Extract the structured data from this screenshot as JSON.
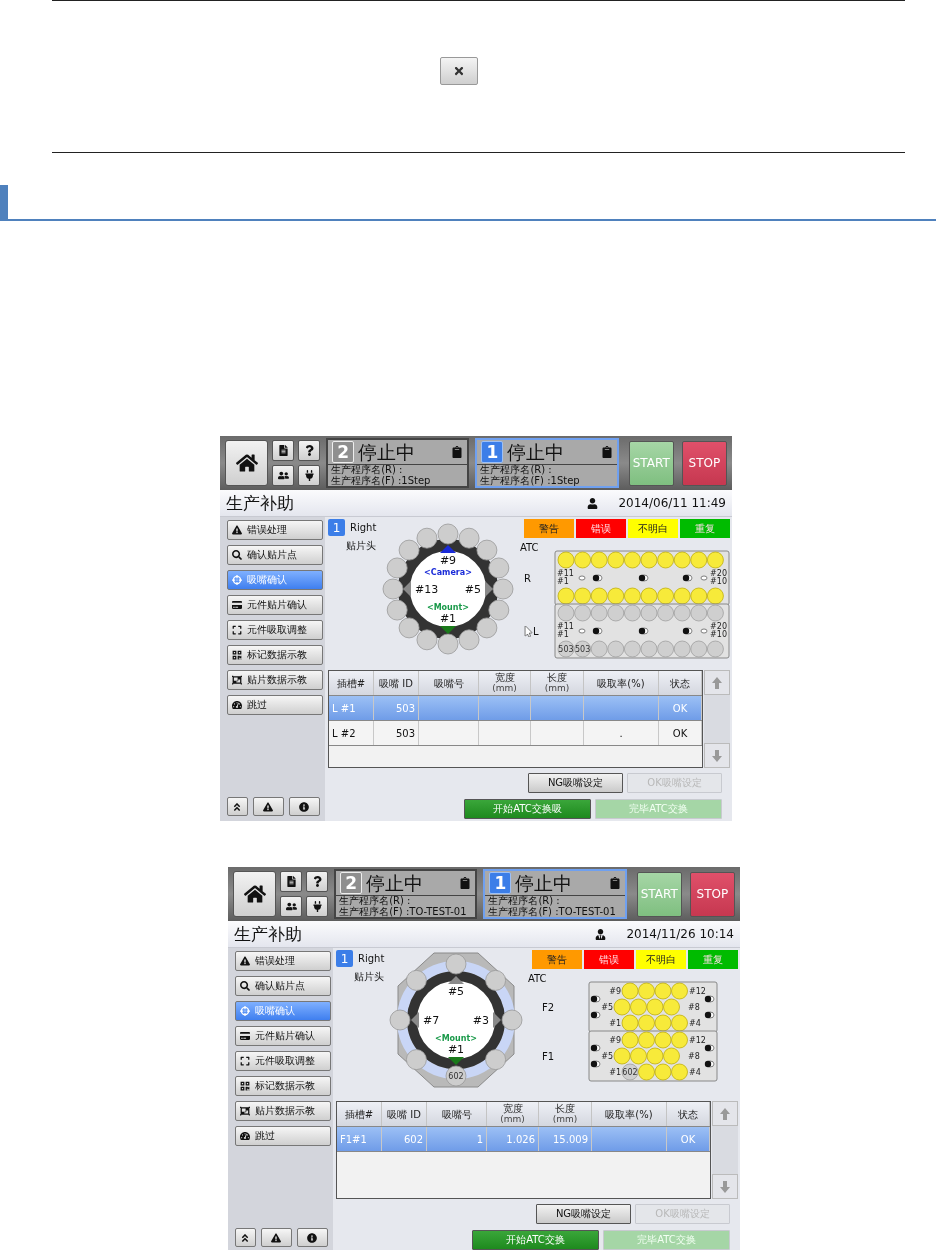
{
  "screens": [
    {
      "header": {
        "panels": [
          {
            "number": "2",
            "status": "停止中",
            "selected": false,
            "program_r": "生产程序名(R) :",
            "program_f": "生产程序名(F) :1Step"
          },
          {
            "number": "1",
            "status": "停止中",
            "selected": true,
            "program_r": "生产程序名(R) :",
            "program_f": "生产程序名(F) :1Step"
          }
        ],
        "start": "START",
        "stop": "STOP"
      },
      "title": "生产补助",
      "datetime": "2014/06/11 11:49",
      "sidebar": {
        "items": [
          {
            "label": "错误处理",
            "selected": false
          },
          {
            "label": "确认贴片点",
            "selected": false
          },
          {
            "label": "吸嘴确认",
            "selected": true
          },
          {
            "label": "元件贴片确认",
            "selected": false
          },
          {
            "label": "元件吸取调整",
            "selected": false
          },
          {
            "label": "标记数据示教",
            "selected": false
          },
          {
            "label": "贴片数据示教",
            "selected": false
          },
          {
            "label": "跳过",
            "selected": false
          }
        ]
      },
      "head": {
        "number": "1",
        "side": "Right",
        "label": "贴片头"
      },
      "wheel": {
        "kind": "round",
        "top": "#9",
        "camera": "<Camera>",
        "left": "#13",
        "right": "#5",
        "mount": "<Mount>",
        "bottom": "#1"
      },
      "legend": [
        {
          "label": "警告",
          "color": "#ff9900"
        },
        {
          "label": "错误",
          "color": "#ff0000"
        },
        {
          "label": "不明白",
          "color": "#ffff00"
        },
        {
          "label": "重复",
          "color": "#00bb00"
        }
      ],
      "atc": {
        "label": "ATC",
        "trays": [
          {
            "name": "R",
            "kind": "strip",
            "pointer": false,
            "marks": [
              "#11",
              "#1",
              "#20",
              "#10"
            ],
            "slots": [
              {
                "loaded": true
              },
              {
                "loaded": true
              },
              {
                "loaded": true
              },
              {
                "loaded": true
              },
              {
                "loaded": true
              },
              {
                "loaded": true
              },
              {
                "loaded": true
              },
              {
                "loaded": true
              },
              {
                "loaded": true
              },
              {
                "loaded": true
              },
              {
                "loaded": true
              },
              {
                "loaded": true
              },
              {
                "loaded": true
              },
              {
                "loaded": true
              },
              {
                "loaded": true
              },
              {
                "loaded": true
              },
              {
                "loaded": true
              },
              {
                "loaded": true
              },
              {
                "loaded": true
              },
              {
                "loaded": true
              }
            ]
          },
          {
            "name": "L",
            "kind": "strip",
            "pointer": true,
            "marks": [
              "#11",
              "#1",
              "#20",
              "#10"
            ],
            "slots": [
              {
                "loaded": false
              },
              {
                "loaded": false
              },
              {
                "loaded": false
              },
              {
                "loaded": false
              },
              {
                "loaded": false
              },
              {
                "loaded": false
              },
              {
                "loaded": false
              },
              {
                "loaded": false
              },
              {
                "loaded": false
              },
              {
                "loaded": false
              },
              {
                "loaded": false,
                "id": "503"
              },
              {
                "loaded": false,
                "id": "503"
              },
              {
                "loaded": false
              },
              {
                "loaded": false
              },
              {
                "loaded": false
              },
              {
                "loaded": false
              },
              {
                "loaded": false
              },
              {
                "loaded": false
              },
              {
                "loaded": false
              },
              {
                "loaded": false
              }
            ]
          }
        ]
      },
      "table": {
        "columns": [
          {
            "label": "插槽#"
          },
          {
            "label": "吸嘴 ID"
          },
          {
            "label": "吸嘴号"
          },
          {
            "label": "宽度",
            "unit": "(mm)"
          },
          {
            "label": "长度",
            "unit": "(mm)"
          },
          {
            "label": "吸取率(%)"
          },
          {
            "label": "状态"
          }
        ],
        "rows": [
          {
            "selected": true,
            "cells": [
              "L #1",
              "503",
              null,
              null,
              null,
              null,
              "OK"
            ]
          },
          {
            "selected": false,
            "cells": [
              "L #2",
              "503",
              null,
              null,
              null,
              ".",
              "OK"
            ]
          }
        ]
      },
      "setting_buttons": [
        {
          "label": "NG吸嘴设定",
          "disabled": false
        },
        {
          "label": "OK吸嘴设定",
          "disabled": true
        }
      ],
      "exchange_buttons": [
        {
          "label": "开始ATC交换吸",
          "disabled": false
        },
        {
          "label": "完毕ATC交换",
          "disabled": true
        }
      ]
    },
    {
      "header": {
        "panels": [
          {
            "number": "2",
            "status": "停止中",
            "selected": false,
            "program_r": "生产程序名(R) :",
            "program_f": "生产程序名(F) :TO-TEST-01"
          },
          {
            "number": "1",
            "status": "停止中",
            "selected": true,
            "program_r": "生产程序名(R) :",
            "program_f": "生产程序名(F) :TO-TEST-01"
          }
        ],
        "start": "START",
        "stop": "STOP"
      },
      "title": "生产补助",
      "datetime": "2014/11/26 10:14",
      "sidebar": {
        "items": [
          {
            "label": "错误处理",
            "selected": false
          },
          {
            "label": "确认贴片点",
            "selected": false
          },
          {
            "label": "吸嘴确认",
            "selected": true
          },
          {
            "label": "元件贴片确认",
            "selected": false
          },
          {
            "label": "元件吸取调整",
            "selected": false
          },
          {
            "label": "标记数据示教",
            "selected": false
          },
          {
            "label": "贴片数据示教",
            "selected": false
          },
          {
            "label": "跳过",
            "selected": false
          }
        ]
      },
      "head": {
        "number": "1",
        "side": "Right",
        "label": "贴片头"
      },
      "wheel": {
        "kind": "octagon",
        "top": "#5",
        "left": "#7",
        "right": "#3",
        "mount": "<Mount>",
        "bottom": "#1",
        "nozzle_id": "602"
      },
      "legend": [
        {
          "label": "警告",
          "color": "#ff9900"
        },
        {
          "label": "错误",
          "color": "#ff0000"
        },
        {
          "label": "不明白",
          "color": "#ffff00"
        },
        {
          "label": "重复",
          "color": "#00bb00"
        }
      ],
      "atc": {
        "label": "ATC",
        "trays": [
          {
            "name": "F2",
            "kind": "grid",
            "pointer": false,
            "marks": [
              "#9",
              "#12",
              "#5",
              "#8",
              "#1",
              "#4"
            ],
            "slots": [
              {
                "loaded": true
              },
              {
                "loaded": true
              },
              {
                "loaded": true
              },
              {
                "loaded": true
              },
              {
                "loaded": true
              },
              {
                "loaded": true
              },
              {
                "loaded": true
              },
              {
                "loaded": true
              },
              {
                "loaded": true
              },
              {
                "loaded": true
              },
              {
                "loaded": true
              },
              {
                "loaded": true
              }
            ]
          },
          {
            "name": "F1",
            "kind": "grid",
            "pointer": false,
            "marks": [
              "#9",
              "#12",
              "#5",
              "#8",
              "#1",
              "#4"
            ],
            "slots": [
              {
                "loaded": true
              },
              {
                "loaded": true
              },
              {
                "loaded": true
              },
              {
                "loaded": true
              },
              {
                "loaded": true
              },
              {
                "loaded": true
              },
              {
                "loaded": true
              },
              {
                "loaded": true
              },
              {
                "loaded": false,
                "id": "602"
              },
              {
                "loaded": true
              },
              {
                "loaded": true
              },
              {
                "loaded": true
              }
            ]
          }
        ]
      },
      "table": {
        "columns": [
          {
            "label": "插槽#"
          },
          {
            "label": "吸嘴 ID"
          },
          {
            "label": "吸嘴号"
          },
          {
            "label": "宽度",
            "unit": "(mm)"
          },
          {
            "label": "长度",
            "unit": "(mm)"
          },
          {
            "label": "吸取率(%)"
          },
          {
            "label": "状态"
          }
        ],
        "rows": [
          {
            "selected": true,
            "cells": [
              "F1#1",
              "602",
              "1",
              "1.026",
              "15.009",
              null,
              "OK"
            ]
          }
        ]
      },
      "setting_buttons": [
        {
          "label": "NG吸嘴设定",
          "disabled": false
        },
        {
          "label": "OK吸嘴设定",
          "disabled": true
        }
      ],
      "exchange_buttons": [
        {
          "label": "开始ATC交换",
          "disabled": false
        },
        {
          "label": "完毕ATC交换",
          "disabled": true
        }
      ]
    }
  ]
}
